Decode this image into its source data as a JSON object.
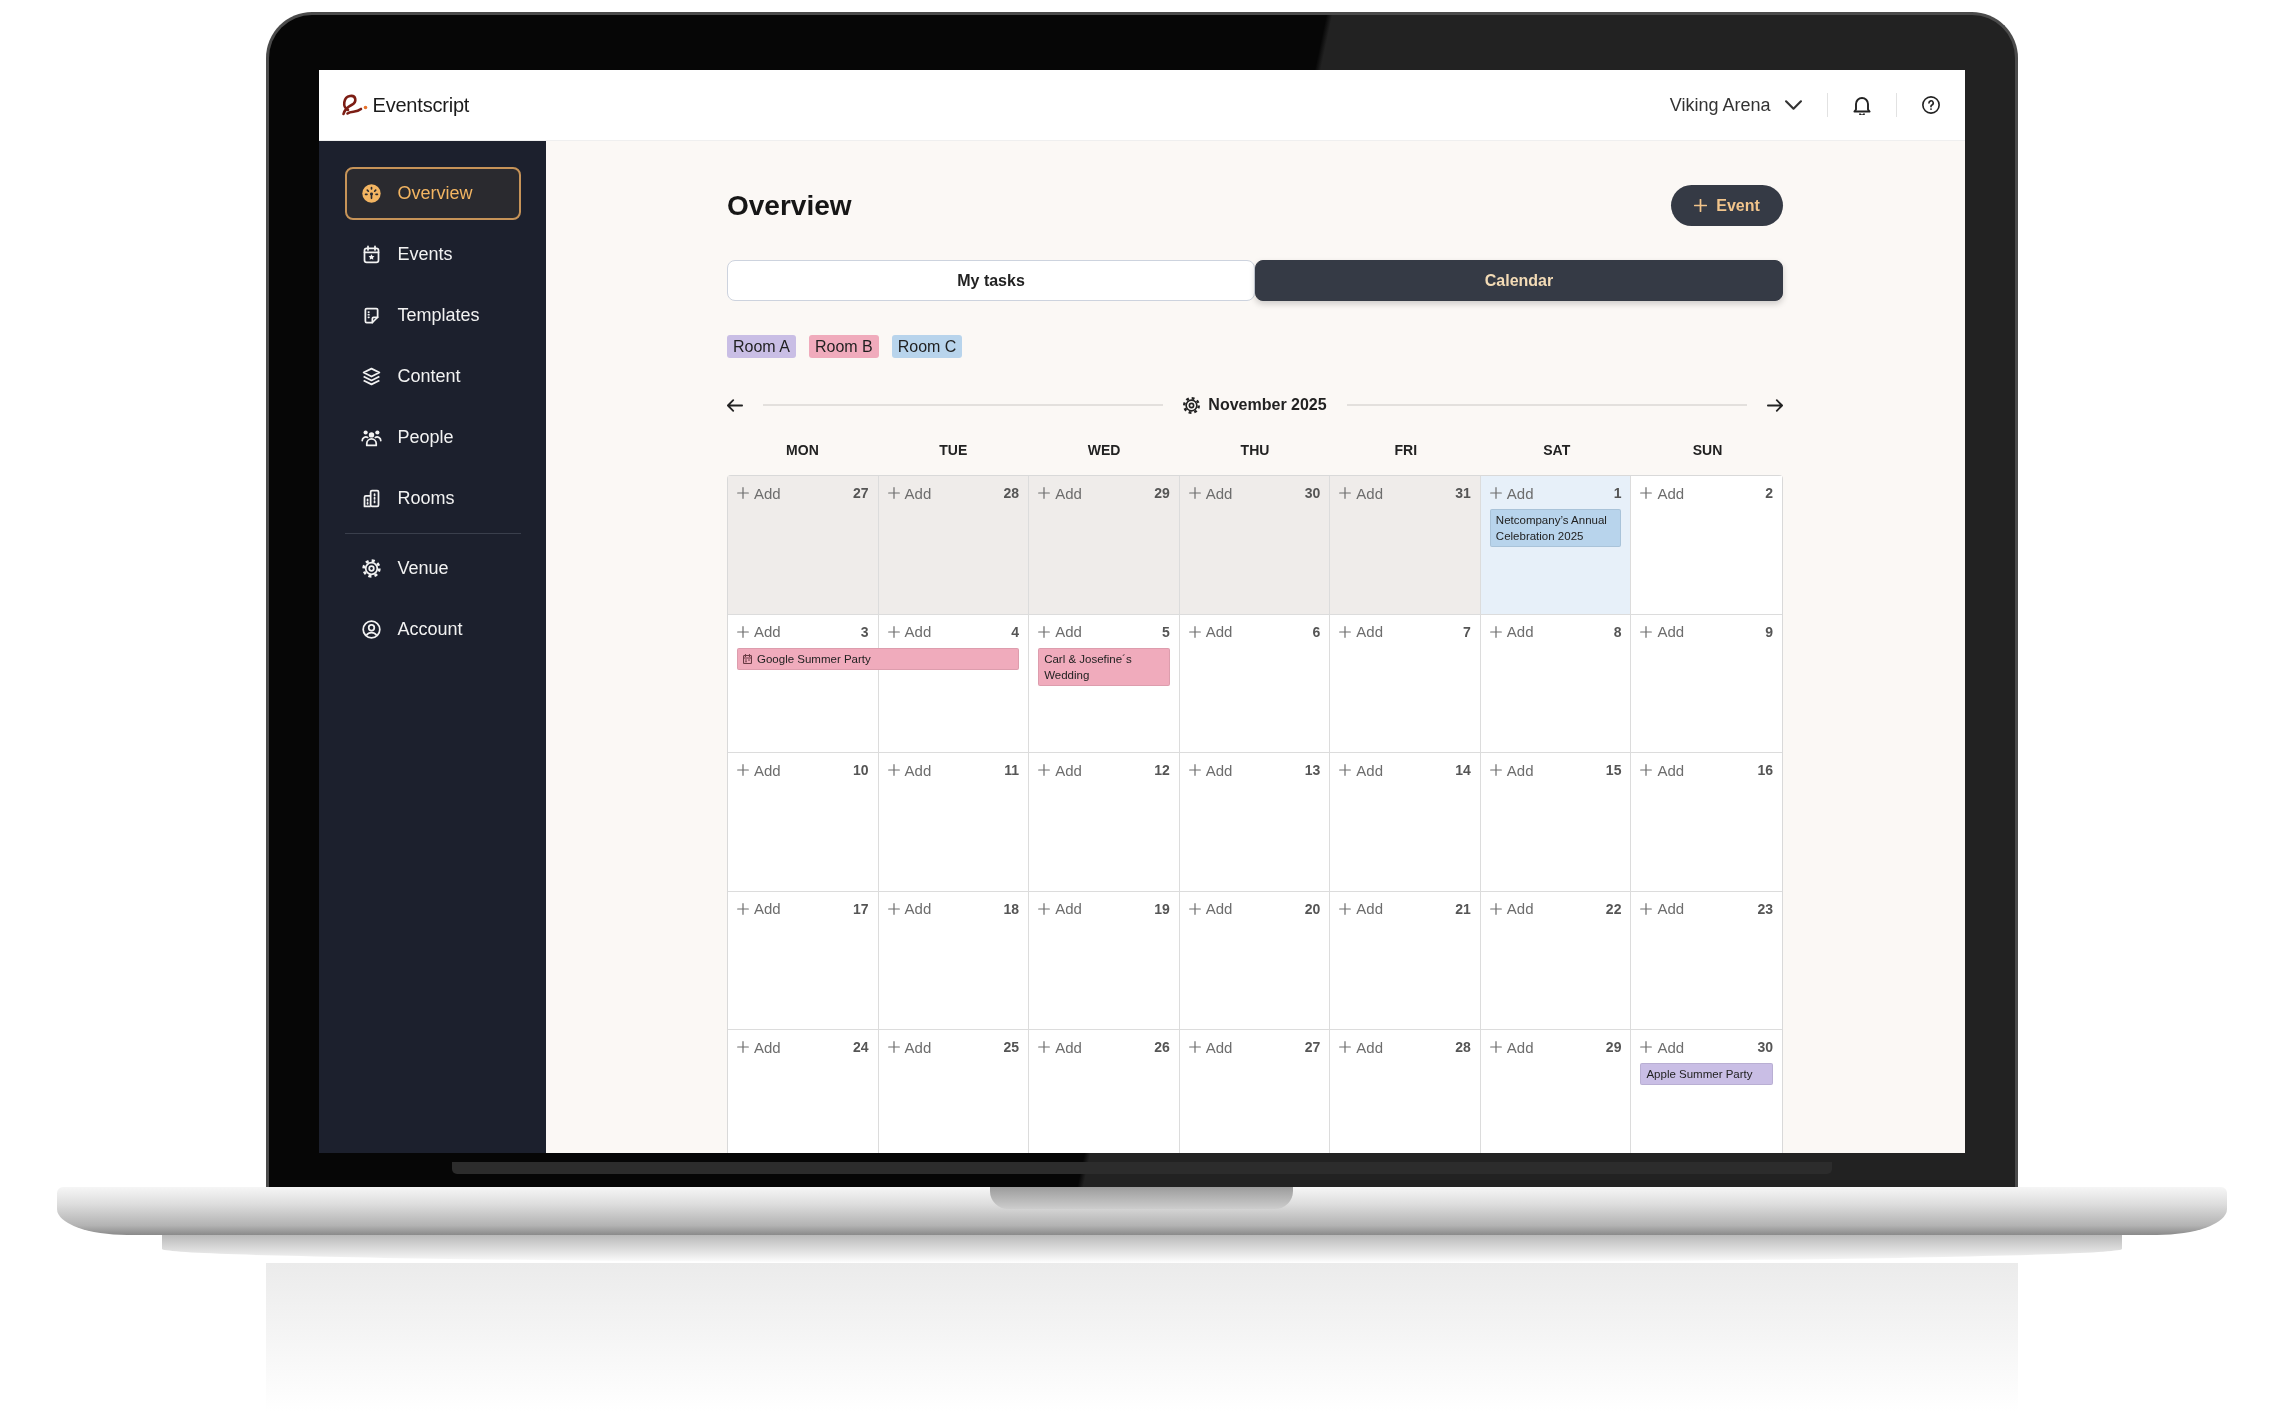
{
  "header": {
    "logo": "Eventscript",
    "venue": "Viking Arena"
  },
  "sidebar": {
    "groups": [
      [
        {
          "label": "Overview",
          "selected": true
        },
        {
          "label": "Events",
          "selected": false
        },
        {
          "label": "Templates",
          "selected": false
        },
        {
          "label": "Content",
          "selected": false
        },
        {
          "label": "People",
          "selected": false
        },
        {
          "label": "Rooms",
          "selected": false
        }
      ],
      [
        {
          "label": "Venue",
          "selected": false
        },
        {
          "label": "Account",
          "selected": false
        }
      ]
    ]
  },
  "main": {
    "title": "Overview",
    "new_event_button": "Event",
    "tabs": [
      {
        "label": "My tasks",
        "selected": false
      },
      {
        "label": "Calendar",
        "selected": true
      }
    ],
    "rooms": [
      {
        "label": "Room A",
        "color": "#c9bee5"
      },
      {
        "label": "Room B",
        "color": "#f0abbc"
      },
      {
        "label": "Room C",
        "color": "#b8d4ec"
      }
    ],
    "calendar": {
      "month": "November 2025",
      "weekdays": [
        "MON",
        "TUE",
        "WED",
        "THU",
        "FRI",
        "SAT",
        "SUN"
      ],
      "weeks": [
        {
          "days": [
            {
              "day": "27",
              "add_label": "Add",
              "outside_month": true,
              "highlighted": false
            },
            {
              "day": "28",
              "add_label": "Add",
              "outside_month": true,
              "highlighted": false
            },
            {
              "day": "29",
              "add_label": "Add",
              "outside_month": true,
              "highlighted": false
            },
            {
              "day": "30",
              "add_label": "Add",
              "outside_month": true,
              "highlighted": false
            },
            {
              "day": "31",
              "add_label": "Add",
              "outside_month": true,
              "highlighted": false
            },
            {
              "day": "1",
              "add_label": "Add",
              "outside_month": false,
              "highlighted": true,
              "events": [
                {
                  "title": "Netcompany’s Annual Celebration 2025",
                  "color": "#b8d4ec",
                  "multi_day": false
                }
              ]
            },
            {
              "day": "2",
              "add_label": "Add",
              "outside_month": false,
              "highlighted": false
            }
          ]
        },
        {
          "days": [
            {
              "day": "3",
              "add_label": "Add",
              "outside_month": false,
              "highlighted": false,
              "events": [
                {
                  "title": "Google Summer Party",
                  "color": "#f0abbc",
                  "multi_day": true
                }
              ]
            },
            {
              "day": "4",
              "add_label": "Add",
              "outside_month": false,
              "highlighted": false
            },
            {
              "day": "5",
              "add_label": "Add",
              "outside_month": false,
              "highlighted": false,
              "events": [
                {
                  "title": "Carl & Josefine´s Wedding",
                  "color": "#f0abbc",
                  "multi_day": false
                }
              ]
            },
            {
              "day": "6",
              "add_label": "Add",
              "outside_month": false,
              "highlighted": false
            },
            {
              "day": "7",
              "add_label": "Add",
              "outside_month": false,
              "highlighted": false
            },
            {
              "day": "8",
              "add_label": "Add",
              "outside_month": false,
              "highlighted": false
            },
            {
              "day": "9",
              "add_label": "Add",
              "outside_month": false,
              "highlighted": false
            }
          ]
        },
        {
          "days": [
            {
              "day": "10",
              "add_label": "Add",
              "outside_month": false,
              "highlighted": false
            },
            {
              "day": "11",
              "add_label": "Add",
              "outside_month": false,
              "highlighted": false
            },
            {
              "day": "12",
              "add_label": "Add",
              "outside_month": false,
              "highlighted": false
            },
            {
              "day": "13",
              "add_label": "Add",
              "outside_month": false,
              "highlighted": false
            },
            {
              "day": "14",
              "add_label": "Add",
              "outside_month": false,
              "highlighted": false
            },
            {
              "day": "15",
              "add_label": "Add",
              "outside_month": false,
              "highlighted": false
            },
            {
              "day": "16",
              "add_label": "Add",
              "outside_month": false,
              "highlighted": false
            }
          ]
        },
        {
          "days": [
            {
              "day": "17",
              "add_label": "Add",
              "outside_month": false,
              "highlighted": false
            },
            {
              "day": "18",
              "add_label": "Add",
              "outside_month": false,
              "highlighted": false
            },
            {
              "day": "19",
              "add_label": "Add",
              "outside_month": false,
              "highlighted": false
            },
            {
              "day": "20",
              "add_label": "Add",
              "outside_month": false,
              "highlighted": false
            },
            {
              "day": "21",
              "add_label": "Add",
              "outside_month": false,
              "highlighted": false
            },
            {
              "day": "22",
              "add_label": "Add",
              "outside_month": false,
              "highlighted": false
            },
            {
              "day": "23",
              "add_label": "Add",
              "outside_month": false,
              "highlighted": false
            }
          ]
        },
        {
          "days": [
            {
              "day": "24",
              "add_label": "Add",
              "outside_month": false,
              "highlighted": false
            },
            {
              "day": "25",
              "add_label": "Add",
              "outside_month": false,
              "highlighted": false
            },
            {
              "day": "26",
              "add_label": "Add",
              "outside_month": false,
              "highlighted": false
            },
            {
              "day": "27",
              "add_label": "Add",
              "outside_month": false,
              "highlighted": false
            },
            {
              "day": "28",
              "add_label": "Add",
              "outside_month": false,
              "highlighted": false
            },
            {
              "day": "29",
              "add_label": "Add",
              "outside_month": false,
              "highlighted": false
            },
            {
              "day": "30",
              "add_label": "Add",
              "outside_month": false,
              "highlighted": false,
              "events": [
                {
                  "title": "Apple Summer Party",
                  "color": "#c9bee5",
                  "multi_day": false
                }
              ]
            }
          ]
        }
      ]
    }
  }
}
